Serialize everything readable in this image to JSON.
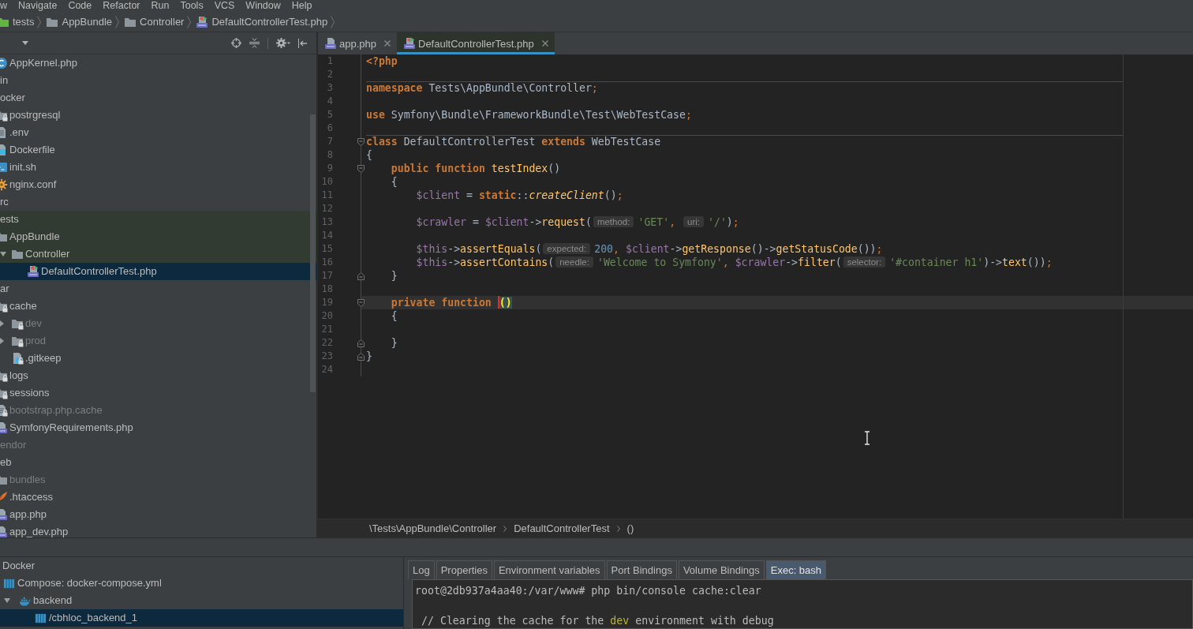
{
  "menu_bar": {
    "items": [
      "w",
      "Navigate",
      "Code",
      "Refactor",
      "Run",
      "Tools",
      "VCS",
      "Window",
      "Help"
    ]
  },
  "navigation_bar": {
    "items": [
      {
        "label": "tests",
        "kind": "testfolder"
      },
      {
        "label": "AppBundle",
        "kind": "folder"
      },
      {
        "label": "Controller",
        "kind": "folder"
      },
      {
        "label": "DefaultControllerTest.php",
        "kind": "phptest"
      }
    ]
  },
  "project_panel": {
    "tree": [
      {
        "children": [
          {
            "label": "AppKernel.php",
            "kind": "class",
            "selected": false,
            "dimmed": false,
            "locked": false,
            "tinted": false
          }
        ]
      },
      {
        "label": "in",
        "selected": false,
        "dimmed": false,
        "tinted": false
      },
      {
        "label": "ocker",
        "selected": false,
        "dimmed": false,
        "tinted": false,
        "children": [
          {
            "label": "postrgresql",
            "kind": "folder",
            "selected": false,
            "dimmed": false,
            "locked": true,
            "tinted": false
          },
          {
            "label": ".env",
            "kind": "text",
            "selected": false,
            "dimmed": false,
            "locked": false,
            "tinted": false
          },
          {
            "label": "Dockerfile",
            "kind": "docker",
            "selected": false,
            "dimmed": false,
            "locked": false,
            "tinted": false
          },
          {
            "label": "init.sh",
            "kind": "shell",
            "selected": false,
            "dimmed": false,
            "locked": false,
            "tinted": false
          },
          {
            "label": "nginx.conf",
            "kind": "config",
            "selected": false,
            "dimmed": false,
            "locked": false,
            "tinted": false
          }
        ]
      },
      {
        "label": "rc",
        "selected": false,
        "dimmed": false,
        "tinted": false
      },
      {
        "label": "ests",
        "selected": false,
        "dimmed": false,
        "tinted": true,
        "children": [
          {
            "label": "AppBundle",
            "kind": "folder",
            "selected": false,
            "dimmed": false,
            "locked": false,
            "tinted": true,
            "children": [
              {
                "label": "Controller",
                "kind": "folder",
                "expanded": true,
                "selected": false,
                "dimmed": false,
                "locked": false,
                "tinted": true,
                "children": [
                  {
                    "label": "DefaultControllerTest.php",
                    "kind": "phptest",
                    "selected": true,
                    "dimmed": false,
                    "locked": false
                  }
                ]
              }
            ]
          }
        ]
      },
      {
        "label": "ar",
        "selected": false,
        "dimmed": false,
        "tinted": false,
        "children": [
          {
            "label": "cache",
            "kind": "folder",
            "selected": false,
            "dimmed": false,
            "locked": true,
            "tinted": false,
            "children": [
              {
                "label": "dev",
                "kind": "folder",
                "expanded": false,
                "selected": false,
                "dimmed": true,
                "locked": true,
                "tinted": false
              },
              {
                "label": "prod",
                "kind": "folder",
                "expanded": false,
                "selected": false,
                "dimmed": true,
                "locked": true,
                "tinted": false
              },
              {
                "label": ".gitkeep",
                "kind": "unknown",
                "selected": false,
                "dimmed": false,
                "locked": true,
                "tinted": false
              }
            ]
          },
          {
            "label": "logs",
            "kind": "folder",
            "selected": false,
            "dimmed": false,
            "locked": true,
            "tinted": false
          },
          {
            "label": "sessions",
            "kind": "folder",
            "selected": false,
            "dimmed": false,
            "locked": true,
            "tinted": false
          },
          {
            "label": "bootstrap.php.cache",
            "kind": "text",
            "selected": false,
            "dimmed": true,
            "locked": true,
            "tinted": false
          },
          {
            "label": "SymfonyRequirements.php",
            "kind": "php",
            "selected": false,
            "dimmed": false,
            "locked": false,
            "tinted": false
          }
        ]
      },
      {
        "label": "endor",
        "selected": false,
        "dimmed": true,
        "tinted": false
      },
      {
        "label": "eb",
        "selected": false,
        "dimmed": false,
        "tinted": false,
        "children": [
          {
            "label": "bundles",
            "kind": "folder",
            "selected": false,
            "dimmed": true,
            "locked": false,
            "tinted": false
          },
          {
            "label": ".htaccess",
            "kind": "feather",
            "selected": false,
            "dimmed": false,
            "locked": false,
            "tinted": false
          },
          {
            "label": "app.php",
            "kind": "php",
            "selected": false,
            "dimmed": false,
            "locked": false,
            "tinted": false
          },
          {
            "label": "app_dev.php",
            "kind": "php",
            "selected": false,
            "dimmed": false,
            "locked": false,
            "tinted": false
          }
        ]
      }
    ]
  },
  "editor": {
    "tabs": [
      {
        "label": "app.php",
        "kind": "php",
        "selected": false
      },
      {
        "label": "DefaultControllerTest.php",
        "kind": "phptest",
        "selected": true
      }
    ],
    "lines": [
      {
        "number": "1",
        "kind": "plain",
        "current": false,
        "separator_above": false,
        "tokens": [
          {
            "text": "<?php",
            "kind": "keyword"
          }
        ]
      },
      {
        "number": "2",
        "kind": "plain",
        "current": false,
        "separator_above": false
      },
      {
        "number": "3",
        "kind": "plain",
        "current": false,
        "separator_above": true,
        "tokens": [
          {
            "text": "namespace",
            "kind": "keyword"
          },
          {
            "text": " Tests\\AppBundle\\Controller",
            "kind": "text"
          },
          {
            "text": ";",
            "kind": "punct"
          }
        ]
      },
      {
        "number": "4",
        "kind": "plain",
        "current": false,
        "separator_above": false
      },
      {
        "number": "5",
        "kind": "plain",
        "current": false,
        "separator_above": false,
        "tokens": [
          {
            "text": "use",
            "kind": "keyword"
          },
          {
            "text": " Symfony\\Bundle\\FrameworkBundle\\Test\\WebTestCase",
            "kind": "text"
          },
          {
            "text": ";",
            "kind": "punct"
          }
        ]
      },
      {
        "number": "6",
        "kind": "plain",
        "current": false,
        "separator_above": false
      },
      {
        "number": "7",
        "kind": "foldstart",
        "current": false,
        "separator_above": true,
        "tokens": [
          {
            "text": "class",
            "kind": "keyword"
          },
          {
            "text": " DefaultControllerTest ",
            "kind": "text"
          },
          {
            "text": "extends",
            "kind": "keyword"
          },
          {
            "text": " WebTestCase",
            "kind": "text"
          }
        ]
      },
      {
        "number": "8",
        "kind": "plain",
        "current": false,
        "separator_above": false,
        "tokens": [
          {
            "text": "{",
            "kind": "text"
          }
        ],
        "children": [
          {
            "number": "9",
            "kind": "foldstart",
            "current": false,
            "separator_above": false,
            "tokens": [
              {
                "text": "public function ",
                "kind": "keyword"
              },
              {
                "text": "testIndex",
                "kind": "method"
              },
              {
                "text": "()",
                "kind": "text"
              }
            ]
          },
          {
            "number": "10",
            "kind": "plain",
            "current": false,
            "separator_above": false,
            "tokens": [
              {
                "text": "{",
                "kind": "text"
              }
            ],
            "children": [
              {
                "number": "11",
                "kind": "plain",
                "current": false,
                "separator_above": false,
                "tokens": [
                  {
                    "text": "$client",
                    "kind": "variable"
                  },
                  {
                    "text": " = ",
                    "kind": "text"
                  },
                  {
                    "text": "static",
                    "kind": "keyword"
                  },
                  {
                    "text": "::",
                    "kind": "text"
                  },
                  {
                    "text": "createClient",
                    "kind": "static"
                  },
                  {
                    "text": "()",
                    "kind": "text"
                  },
                  {
                    "text": ";",
                    "kind": "punct"
                  }
                ]
              },
              {
                "number": "12",
                "kind": "plain",
                "current": false,
                "separator_above": false
              },
              {
                "number": "13",
                "kind": "plain",
                "current": false,
                "separator_above": false,
                "tokens": [
                  {
                    "text": "$crawler",
                    "kind": "variable"
                  },
                  {
                    "text": " = ",
                    "kind": "text"
                  },
                  {
                    "text": "$client",
                    "kind": "variable"
                  },
                  {
                    "text": "->",
                    "kind": "text"
                  },
                  {
                    "text": "request",
                    "kind": "method"
                  },
                  {
                    "text": "(",
                    "kind": "text"
                  },
                  {
                    "text": "method:",
                    "kind": "hint"
                  },
                  {
                    "text": "'GET'",
                    "kind": "string"
                  },
                  {
                    "text": ", ",
                    "kind": "punct"
                  },
                  {
                    "text": "uri:",
                    "kind": "hint"
                  },
                  {
                    "text": "'/'",
                    "kind": "string"
                  },
                  {
                    "text": ")",
                    "kind": "text"
                  },
                  {
                    "text": ";",
                    "kind": "punct"
                  }
                ]
              },
              {
                "number": "14",
                "kind": "plain",
                "current": false,
                "separator_above": false
              },
              {
                "number": "15",
                "kind": "plain",
                "current": false,
                "separator_above": false,
                "tokens": [
                  {
                    "text": "$this",
                    "kind": "variable"
                  },
                  {
                    "text": "->",
                    "kind": "text"
                  },
                  {
                    "text": "assertEquals",
                    "kind": "method"
                  },
                  {
                    "text": "(",
                    "kind": "text"
                  },
                  {
                    "text": "expected:",
                    "kind": "hint"
                  },
                  {
                    "text": "200",
                    "kind": "number"
                  },
                  {
                    "text": ", ",
                    "kind": "punct"
                  },
                  {
                    "text": "$client",
                    "kind": "variable"
                  },
                  {
                    "text": "->",
                    "kind": "text"
                  },
                  {
                    "text": "getResponse",
                    "kind": "method"
                  },
                  {
                    "text": "()->",
                    "kind": "text"
                  },
                  {
                    "text": "getStatusCode",
                    "kind": "method"
                  },
                  {
                    "text": "())",
                    "kind": "text"
                  },
                  {
                    "text": ";",
                    "kind": "punct"
                  }
                ]
              },
              {
                "number": "16",
                "kind": "plain",
                "current": false,
                "separator_above": false,
                "tokens": [
                  {
                    "text": "$this",
                    "kind": "variable"
                  },
                  {
                    "text": "->",
                    "kind": "text"
                  },
                  {
                    "text": "assertContains",
                    "kind": "method"
                  },
                  {
                    "text": "(",
                    "kind": "text"
                  },
                  {
                    "text": "needle:",
                    "kind": "hint"
                  },
                  {
                    "text": "'Welcome to Symfony'",
                    "kind": "string"
                  },
                  {
                    "text": ", ",
                    "kind": "punct"
                  },
                  {
                    "text": "$crawler",
                    "kind": "variable"
                  },
                  {
                    "text": "->",
                    "kind": "text"
                  },
                  {
                    "text": "filter",
                    "kind": "method"
                  },
                  {
                    "text": "(",
                    "kind": "text"
                  },
                  {
                    "text": "selector:",
                    "kind": "hint"
                  },
                  {
                    "text": "'#container h1'",
                    "kind": "string"
                  },
                  {
                    "text": ")->",
                    "kind": "text"
                  },
                  {
                    "text": "text",
                    "kind": "method"
                  },
                  {
                    "text": "())",
                    "kind": "text"
                  },
                  {
                    "text": ";",
                    "kind": "punct"
                  }
                ]
              }
            ]
          },
          {
            "number": "17",
            "kind": "foldend",
            "current": false,
            "separator_above": false,
            "tokens": [
              {
                "text": "}",
                "kind": "text"
              }
            ]
          },
          {
            "number": "18",
            "kind": "plain",
            "current": false,
            "separator_above": false
          },
          {
            "number": "19",
            "kind": "foldstart",
            "current": true,
            "separator_above": false,
            "tokens": [
              {
                "text": "private function ",
                "kind": "keyword"
              },
              {
                "kind": "caret"
              },
              {
                "text": "()",
                "kind": "brace"
              }
            ]
          },
          {
            "number": "20",
            "kind": "plain",
            "current": false,
            "separator_above": false,
            "tokens": [
              {
                "text": "{",
                "kind": "text"
              }
            ],
            "children": [
              {
                "number": "21",
                "kind": "plain",
                "current": false,
                "separator_above": false
              }
            ]
          },
          {
            "number": "22",
            "kind": "foldend",
            "current": false,
            "separator_above": false,
            "tokens": [
              {
                "text": "}",
                "kind": "text"
              }
            ]
          }
        ]
      },
      {
        "number": "23",
        "kind": "foldend",
        "current": false,
        "separator_above": false,
        "tokens": [
          {
            "text": "}",
            "kind": "text"
          }
        ]
      },
      {
        "number": "24",
        "kind": "plain",
        "current": false,
        "separator_above": false
      }
    ],
    "breadcrumb": [
      "\\Tests\\AppBundle\\Controller",
      "DefaultControllerTest",
      "()"
    ]
  },
  "docker_panel": {
    "tree": [
      {
        "label": "Docker",
        "selected": false,
        "children": [
          {
            "label": "Compose: docker-compose.yml",
            "kind": "compose",
            "selected": false,
            "children": [
              {
                "label": "backend",
                "kind": "service",
                "expanded": true,
                "selected": false,
                "children": [
                  {
                    "label": "/cbhloc_backend_1",
                    "kind": "container",
                    "selected": true
                  }
                ]
              }
            ]
          }
        ]
      }
    ],
    "tabs": [
      {
        "label": "Log",
        "selected": false
      },
      {
        "label": "Properties",
        "selected": false
      },
      {
        "label": "Environment variables",
        "selected": false
      },
      {
        "label": "Port Bindings",
        "selected": false
      },
      {
        "label": "Volume Bindings",
        "selected": false
      },
      {
        "label": "Exec: bash",
        "selected": true
      }
    ],
    "terminal": {
      "lines": [
        {
          "segments": [
            {
              "text": "root@2db937a4aa40:/var/www# php bin/console cache:clear",
              "kind": "plain"
            }
          ]
        },
        {
          "segments": [
            {
              "text": " // Clearing the cache for the ",
              "kind": "plain"
            },
            {
              "text": "dev",
              "kind": "highlight"
            },
            {
              "text": " environment with debug",
              "kind": "plain"
            }
          ]
        }
      ]
    }
  }
}
